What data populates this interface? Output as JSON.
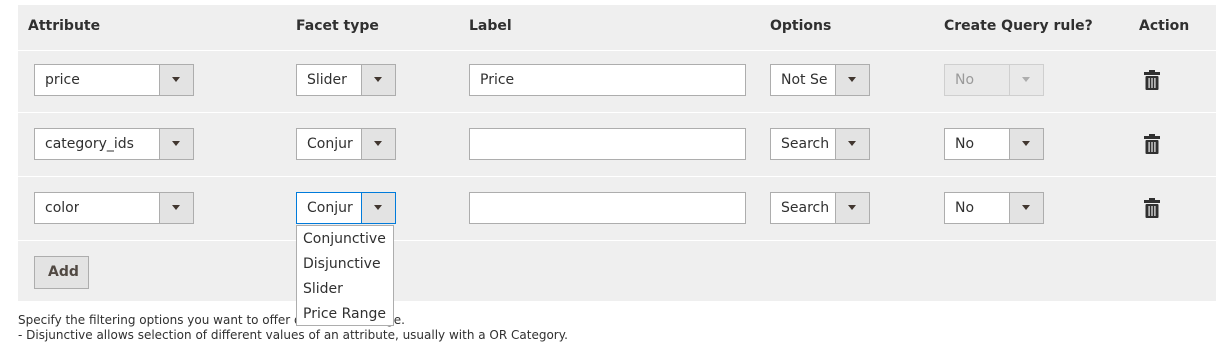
{
  "headers": {
    "attribute": "Attribute",
    "facet_type": "Facet type",
    "label": "Label",
    "options": "Options",
    "create_query_rule": "Create Query rule?",
    "action": "Action"
  },
  "rows": [
    {
      "attribute": "price",
      "facet_type": "Slider",
      "label": "Price",
      "options": "Not Se",
      "query_rule": "No",
      "query_rule_disabled": true
    },
    {
      "attribute": "category_ids",
      "facet_type": "Conjur",
      "label": "",
      "options": "Search",
      "query_rule": "No",
      "query_rule_disabled": false
    },
    {
      "attribute": "color",
      "facet_type": "Conjur",
      "label": "",
      "options": "Search",
      "query_rule": "No",
      "query_rule_disabled": false
    }
  ],
  "facet_type_dropdown": {
    "open": true,
    "options": [
      "Conjunctive",
      "Disjunctive",
      "Slider",
      "Price Range"
    ]
  },
  "add_button_label": "Add",
  "help_text": {
    "line1_start": "Specify the filtering options you want to offer on a",
    "line1_end": "ge.",
    "line2": "- Disjunctive allows selection of different values of an attribute, usually with a OR Category."
  },
  "icons": {
    "delete": "trash-icon",
    "select_arrow": "chevron-down-icon"
  },
  "colors": {
    "panel_bg": "#efefef",
    "border": "#adadad",
    "focus": "#007bdb",
    "button_bg": "#e3e3e3"
  }
}
